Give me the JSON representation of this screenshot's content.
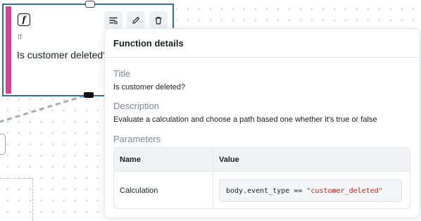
{
  "node": {
    "icon": "function-icon",
    "type_label": "If",
    "title": "Is customer deleted?",
    "accent_color": "#d6428f",
    "border_color": "#2f6fa8",
    "toolbar": [
      {
        "icon": "details-icon"
      },
      {
        "icon": "edit-icon"
      },
      {
        "icon": "trash-icon"
      }
    ]
  },
  "popover": {
    "title": "Function details",
    "sections": {
      "title_label": "Title",
      "title_value": "Is customer deleted?",
      "description_label": "Description",
      "description_value": "Evaluate a calculation and choose a path based one whether it's true or false",
      "parameters_label": "Parameters"
    },
    "table": {
      "headers": [
        "Name",
        "Value"
      ],
      "rows": [
        {
          "name": "Calculation",
          "code_prefix": "body.event_type == ",
          "code_string": "\"customer_deleted\""
        }
      ]
    }
  }
}
